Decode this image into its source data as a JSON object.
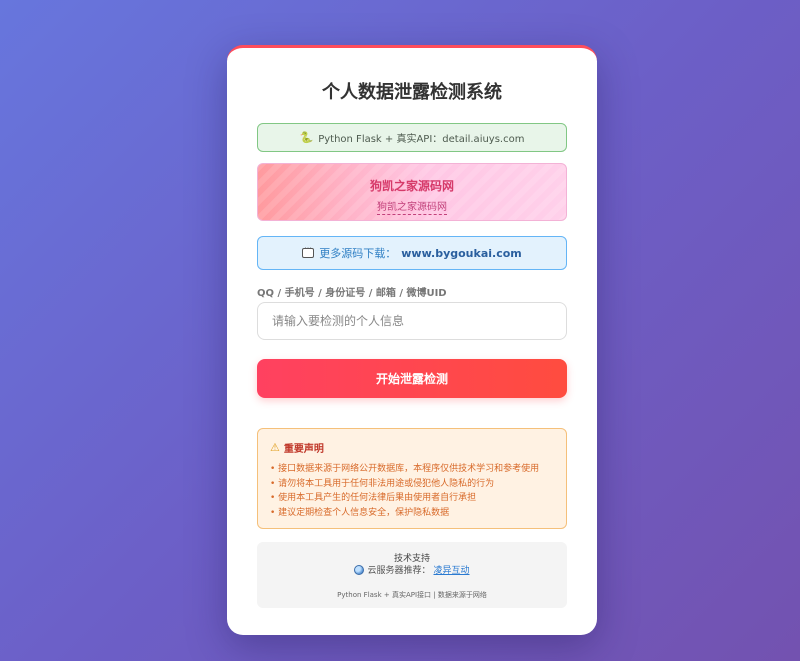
{
  "app": {
    "title": "个人数据泄露检测系统"
  },
  "api_banner": {
    "icon": "snake-icon",
    "text": "Python Flask + 真实API：detail.aiuys.com"
  },
  "ad_banner": {
    "title": "狗凯之家源码网",
    "link_text": "狗凯之家源码网"
  },
  "more_banner": {
    "icon": "chat-icon",
    "label": "更多源码下载：",
    "site": "www.bygoukai.com"
  },
  "search": {
    "label": "QQ / 手机号 / 身份证号 / 邮箱 / 微博UID",
    "placeholder": "请输入要检测的个人信息",
    "value": ""
  },
  "submit": {
    "label": "开始泄露检测"
  },
  "notice": {
    "icon": "warning-icon",
    "title": "重要声明",
    "items": [
      "• 接口数据来源于网络公开数据库，本程序仅供技术学习和参考使用",
      "• 请勿将本工具用于任何非法用途或侵犯他人隐私的行为",
      "• 使用本工具产生的任何法律后果由使用者自行承担",
      "• 建议定期检查个人信息安全，保护隐私数据"
    ]
  },
  "tech": {
    "title": "技术支持",
    "icon": "globe-icon",
    "server_label": "云服务器推荐：",
    "server_link": "凌异互动",
    "footer": "Python Flask + 真实API接口 | 数据来源于网络"
  },
  "colors": {
    "accent": "#ff4160",
    "background_start": "#6776dd",
    "background_end": "#7352b0"
  }
}
